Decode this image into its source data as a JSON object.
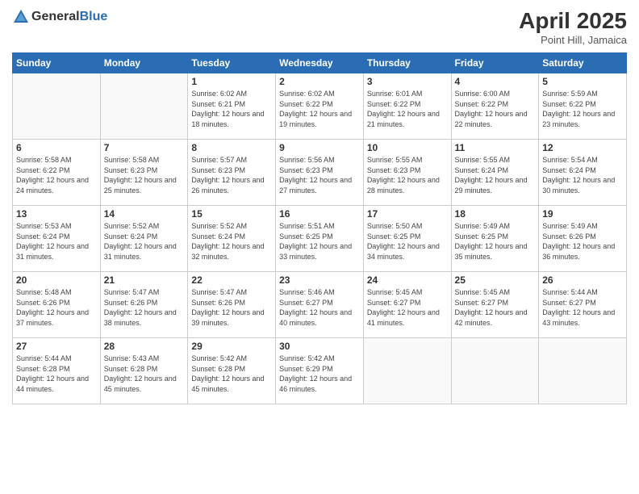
{
  "header": {
    "logo_general": "General",
    "logo_blue": "Blue",
    "month_year": "April 2025",
    "location": "Point Hill, Jamaica"
  },
  "days_of_week": [
    "Sunday",
    "Monday",
    "Tuesday",
    "Wednesday",
    "Thursday",
    "Friday",
    "Saturday"
  ],
  "weeks": [
    [
      {
        "day": "",
        "sunrise": "",
        "sunset": "",
        "daylight": ""
      },
      {
        "day": "",
        "sunrise": "",
        "sunset": "",
        "daylight": ""
      },
      {
        "day": "1",
        "sunrise": "Sunrise: 6:02 AM",
        "sunset": "Sunset: 6:21 PM",
        "daylight": "Daylight: 12 hours and 18 minutes."
      },
      {
        "day": "2",
        "sunrise": "Sunrise: 6:02 AM",
        "sunset": "Sunset: 6:22 PM",
        "daylight": "Daylight: 12 hours and 19 minutes."
      },
      {
        "day": "3",
        "sunrise": "Sunrise: 6:01 AM",
        "sunset": "Sunset: 6:22 PM",
        "daylight": "Daylight: 12 hours and 21 minutes."
      },
      {
        "day": "4",
        "sunrise": "Sunrise: 6:00 AM",
        "sunset": "Sunset: 6:22 PM",
        "daylight": "Daylight: 12 hours and 22 minutes."
      },
      {
        "day": "5",
        "sunrise": "Sunrise: 5:59 AM",
        "sunset": "Sunset: 6:22 PM",
        "daylight": "Daylight: 12 hours and 23 minutes."
      }
    ],
    [
      {
        "day": "6",
        "sunrise": "Sunrise: 5:58 AM",
        "sunset": "Sunset: 6:22 PM",
        "daylight": "Daylight: 12 hours and 24 minutes."
      },
      {
        "day": "7",
        "sunrise": "Sunrise: 5:58 AM",
        "sunset": "Sunset: 6:23 PM",
        "daylight": "Daylight: 12 hours and 25 minutes."
      },
      {
        "day": "8",
        "sunrise": "Sunrise: 5:57 AM",
        "sunset": "Sunset: 6:23 PM",
        "daylight": "Daylight: 12 hours and 26 minutes."
      },
      {
        "day": "9",
        "sunrise": "Sunrise: 5:56 AM",
        "sunset": "Sunset: 6:23 PM",
        "daylight": "Daylight: 12 hours and 27 minutes."
      },
      {
        "day": "10",
        "sunrise": "Sunrise: 5:55 AM",
        "sunset": "Sunset: 6:23 PM",
        "daylight": "Daylight: 12 hours and 28 minutes."
      },
      {
        "day": "11",
        "sunrise": "Sunrise: 5:55 AM",
        "sunset": "Sunset: 6:24 PM",
        "daylight": "Daylight: 12 hours and 29 minutes."
      },
      {
        "day": "12",
        "sunrise": "Sunrise: 5:54 AM",
        "sunset": "Sunset: 6:24 PM",
        "daylight": "Daylight: 12 hours and 30 minutes."
      }
    ],
    [
      {
        "day": "13",
        "sunrise": "Sunrise: 5:53 AM",
        "sunset": "Sunset: 6:24 PM",
        "daylight": "Daylight: 12 hours and 31 minutes."
      },
      {
        "day": "14",
        "sunrise": "Sunrise: 5:52 AM",
        "sunset": "Sunset: 6:24 PM",
        "daylight": "Daylight: 12 hours and 31 minutes."
      },
      {
        "day": "15",
        "sunrise": "Sunrise: 5:52 AM",
        "sunset": "Sunset: 6:24 PM",
        "daylight": "Daylight: 12 hours and 32 minutes."
      },
      {
        "day": "16",
        "sunrise": "Sunrise: 5:51 AM",
        "sunset": "Sunset: 6:25 PM",
        "daylight": "Daylight: 12 hours and 33 minutes."
      },
      {
        "day": "17",
        "sunrise": "Sunrise: 5:50 AM",
        "sunset": "Sunset: 6:25 PM",
        "daylight": "Daylight: 12 hours and 34 minutes."
      },
      {
        "day": "18",
        "sunrise": "Sunrise: 5:49 AM",
        "sunset": "Sunset: 6:25 PM",
        "daylight": "Daylight: 12 hours and 35 minutes."
      },
      {
        "day": "19",
        "sunrise": "Sunrise: 5:49 AM",
        "sunset": "Sunset: 6:26 PM",
        "daylight": "Daylight: 12 hours and 36 minutes."
      }
    ],
    [
      {
        "day": "20",
        "sunrise": "Sunrise: 5:48 AM",
        "sunset": "Sunset: 6:26 PM",
        "daylight": "Daylight: 12 hours and 37 minutes."
      },
      {
        "day": "21",
        "sunrise": "Sunrise: 5:47 AM",
        "sunset": "Sunset: 6:26 PM",
        "daylight": "Daylight: 12 hours and 38 minutes."
      },
      {
        "day": "22",
        "sunrise": "Sunrise: 5:47 AM",
        "sunset": "Sunset: 6:26 PM",
        "daylight": "Daylight: 12 hours and 39 minutes."
      },
      {
        "day": "23",
        "sunrise": "Sunrise: 5:46 AM",
        "sunset": "Sunset: 6:27 PM",
        "daylight": "Daylight: 12 hours and 40 minutes."
      },
      {
        "day": "24",
        "sunrise": "Sunrise: 5:45 AM",
        "sunset": "Sunset: 6:27 PM",
        "daylight": "Daylight: 12 hours and 41 minutes."
      },
      {
        "day": "25",
        "sunrise": "Sunrise: 5:45 AM",
        "sunset": "Sunset: 6:27 PM",
        "daylight": "Daylight: 12 hours and 42 minutes."
      },
      {
        "day": "26",
        "sunrise": "Sunrise: 5:44 AM",
        "sunset": "Sunset: 6:27 PM",
        "daylight": "Daylight: 12 hours and 43 minutes."
      }
    ],
    [
      {
        "day": "27",
        "sunrise": "Sunrise: 5:44 AM",
        "sunset": "Sunset: 6:28 PM",
        "daylight": "Daylight: 12 hours and 44 minutes."
      },
      {
        "day": "28",
        "sunrise": "Sunrise: 5:43 AM",
        "sunset": "Sunset: 6:28 PM",
        "daylight": "Daylight: 12 hours and 45 minutes."
      },
      {
        "day": "29",
        "sunrise": "Sunrise: 5:42 AM",
        "sunset": "Sunset: 6:28 PM",
        "daylight": "Daylight: 12 hours and 45 minutes."
      },
      {
        "day": "30",
        "sunrise": "Sunrise: 5:42 AM",
        "sunset": "Sunset: 6:29 PM",
        "daylight": "Daylight: 12 hours and 46 minutes."
      },
      {
        "day": "",
        "sunrise": "",
        "sunset": "",
        "daylight": ""
      },
      {
        "day": "",
        "sunrise": "",
        "sunset": "",
        "daylight": ""
      },
      {
        "day": "",
        "sunrise": "",
        "sunset": "",
        "daylight": ""
      }
    ]
  ]
}
